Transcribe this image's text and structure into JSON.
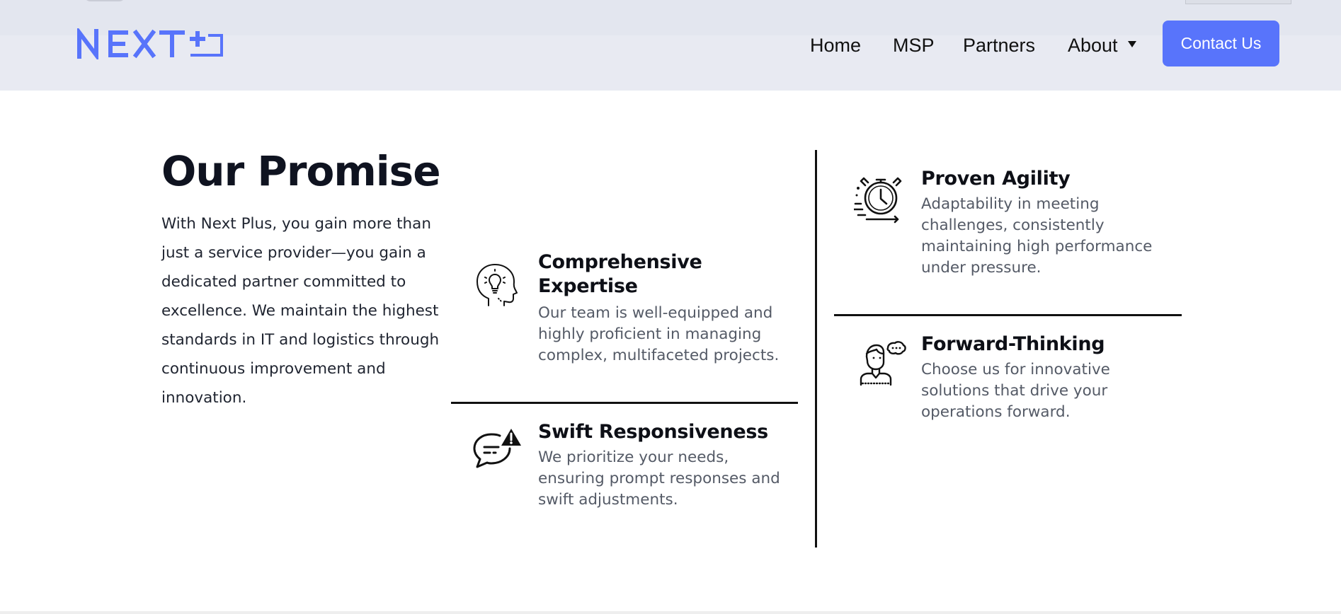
{
  "header": {
    "logo_alt": "NEXT+",
    "nav": {
      "home": "Home",
      "msp": "MSP",
      "partners": "Partners",
      "about": "About"
    },
    "contact_button": "Contact Us",
    "colors": {
      "brand": "#5874fb",
      "header_bg": "#e8eaf2"
    }
  },
  "intro": {
    "title": "Our Promise",
    "text": "With Next Plus, you gain more than just a service provider—you gain a dedicated partner committed to excellence. We maintain the highest standards in IT and logistics through continuous improvement and innovation."
  },
  "features": [
    {
      "icon": "head-lightbulb-icon",
      "title": "Comprehensive Expertise",
      "text": "Our team is well-equipped and highly proficient in managing complex, multifaceted projects."
    },
    {
      "icon": "chat-alert-icon",
      "title": "Swift Responsiveness",
      "text": "We prioritize your needs, ensuring prompt responses and swift adjustments."
    },
    {
      "icon": "stopwatch-icon",
      "title": "Proven Agility",
      "text": "Adaptability in meeting challenges, consistently maintaining high performance under pressure."
    },
    {
      "icon": "person-thinking-icon",
      "title": "Forward-Thinking",
      "text": "Choose us for innovative solutions that drive your operations forward."
    }
  ]
}
